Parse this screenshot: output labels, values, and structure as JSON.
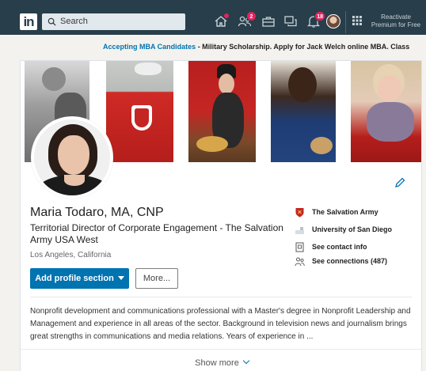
{
  "nav": {
    "logo": "in",
    "search_placeholder": "Search",
    "badges": {
      "network": "2",
      "notifications": "18"
    },
    "premium_line1": "Reactivate",
    "premium_line2": "Premium for Free"
  },
  "ad": {
    "link": "Accepting MBA Candidates",
    "text": " - Military Scholarship. Apply for Jack Welch online MBA. Class"
  },
  "profile": {
    "name": "Maria Todaro, MA, CNP",
    "headline": "Territorial Director of Corporate Engagement - The Salvation Army USA West",
    "location": "Los Angeles, California",
    "add_section_label": "Add profile section",
    "more_label": "More...",
    "side": {
      "company": "The Salvation Army",
      "school": "University of San Diego",
      "contact": "See contact info",
      "connections": "See connections (487)"
    },
    "summary": "Nonprofit development and communications professional with a Master's degree in Nonprofit Leadership and Management and experience in all areas of the sector. Background in television news and journalism brings great strengths in communications and media relations. Years of experience in ...",
    "show_more": "Show more"
  },
  "colors": {
    "nav_bg": "#283e4a",
    "accent": "#0073b1",
    "badge": "#e0245e",
    "salvation_red": "#c42623"
  },
  "icons": [
    "home-icon",
    "my-network-icon",
    "jobs-icon",
    "messaging-icon",
    "notifications-icon",
    "apps-grid-icon",
    "pencil-icon",
    "shield-icon",
    "school-icon",
    "contact-card-icon",
    "people-icon",
    "chevron-down-icon",
    "search-icon"
  ]
}
